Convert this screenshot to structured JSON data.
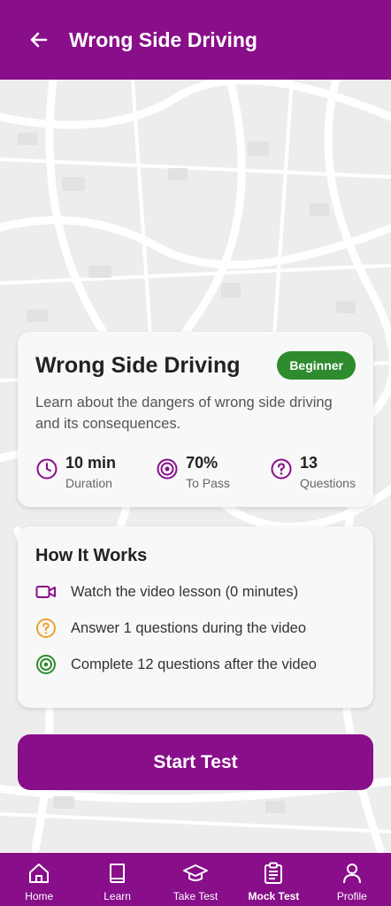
{
  "header": {
    "title": "Wrong Side Driving"
  },
  "lesson": {
    "title": "Wrong Side Driving",
    "badge": "Beginner",
    "description": "Learn about the dangers of wrong side driving and its consequences.",
    "stats": [
      {
        "value": "10 min",
        "label": "Duration",
        "icon": "clock-icon"
      },
      {
        "value": "70%",
        "label": "To Pass",
        "icon": "target-icon"
      },
      {
        "value": "13",
        "label": "Questions",
        "icon": "question-icon"
      }
    ]
  },
  "how_it_works": {
    "title": "How It Works",
    "steps": [
      {
        "text": "Watch the video lesson (0 minutes)",
        "icon": "video-icon",
        "color": "#880e8a"
      },
      {
        "text": "Answer 1 questions during the video",
        "icon": "question-icon",
        "color": "#f0a030"
      },
      {
        "text": "Complete 12 questions after the video",
        "icon": "target-icon",
        "color": "#2e8b2e"
      }
    ]
  },
  "start_button": {
    "label": "Start Test"
  },
  "tabs": [
    {
      "label": "Home",
      "icon": "home-icon",
      "active": false
    },
    {
      "label": "Learn",
      "icon": "book-icon",
      "active": false
    },
    {
      "label": "Take Test",
      "icon": "graduation-cap-icon",
      "active": false
    },
    {
      "label": "Mock Test",
      "icon": "clipboard-icon",
      "active": true
    },
    {
      "label": "Profile",
      "icon": "person-icon",
      "active": false
    }
  ],
  "colors": {
    "primary": "#880e8a",
    "badge": "#2e8b2e",
    "accent_orange": "#f0a030"
  }
}
